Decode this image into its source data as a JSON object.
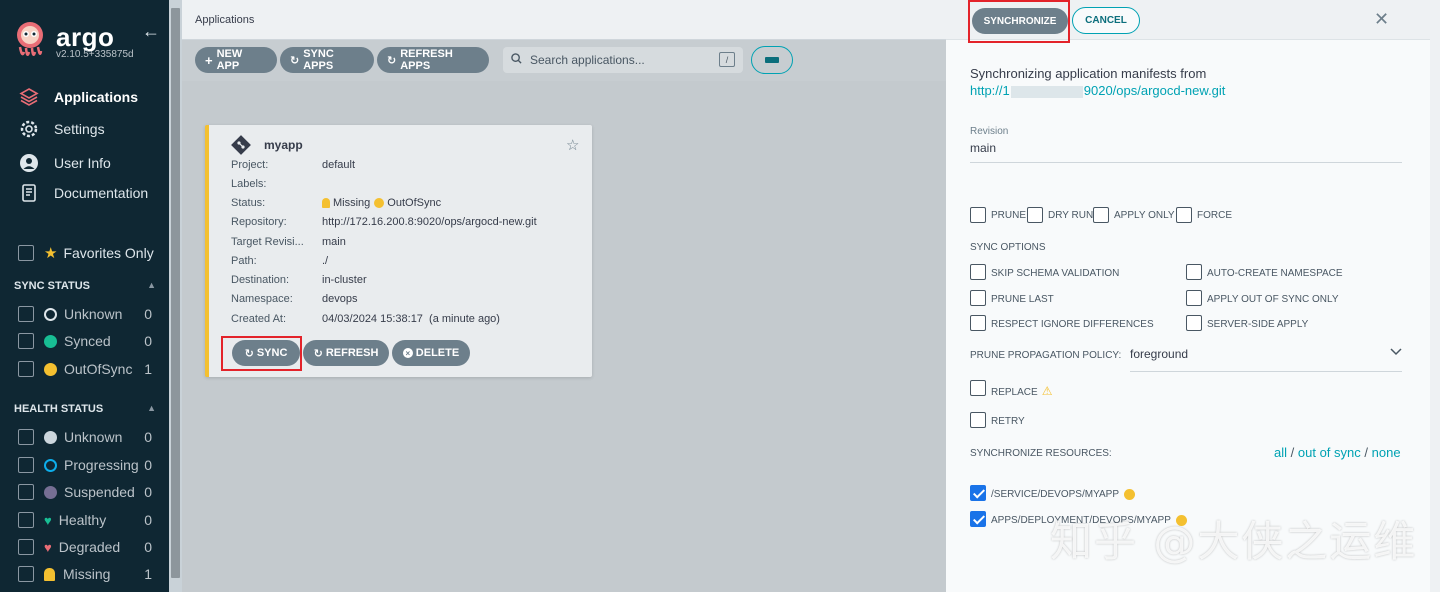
{
  "sidebar": {
    "brand": "argo",
    "version": "v2.10.5+335875d",
    "nav": [
      {
        "label": "Applications",
        "icon": "layers-icon"
      },
      {
        "label": "Settings",
        "icon": "gear-icon"
      },
      {
        "label": "User Info",
        "icon": "user-icon"
      },
      {
        "label": "Documentation",
        "icon": "book-icon"
      }
    ],
    "favorites_label": "Favorites Only",
    "sync_status": {
      "title": "SYNC STATUS",
      "items": [
        {
          "label": "Unknown",
          "count": "0",
          "color": "#dee6eb"
        },
        {
          "label": "Synced",
          "count": "0",
          "color": "#18be94"
        },
        {
          "label": "OutOfSync",
          "count": "1",
          "color": "#f4c030"
        }
      ]
    },
    "health_status": {
      "title": "HEALTH STATUS",
      "items": [
        {
          "label": "Unknown",
          "count": "0",
          "color": "#ccd6dd"
        },
        {
          "label": "Progressing",
          "count": "0",
          "color": "#0dadea"
        },
        {
          "label": "Suspended",
          "count": "0",
          "color": "#766f94"
        },
        {
          "label": "Healthy",
          "count": "0",
          "color": "#18be94"
        },
        {
          "label": "Degraded",
          "count": "0",
          "color": "#e96d76"
        },
        {
          "label": "Missing",
          "count": "1",
          "color": "#f4c030"
        }
      ]
    }
  },
  "header": {
    "breadcrumb": "Applications"
  },
  "toolbar": {
    "new_app": "NEW APP",
    "sync_apps": "SYNC APPS",
    "refresh_apps": "REFRESH APPS",
    "search_placeholder": "Search applications...",
    "search_shortcut": "/"
  },
  "app_card": {
    "name": "myapp",
    "fields": [
      {
        "key": "Project:",
        "value": "default"
      },
      {
        "key": "Labels:",
        "value": ""
      },
      {
        "key": "Status:",
        "value": ""
      },
      {
        "key": "Repository:",
        "value": "http://172.16.200.8:9020/ops/argocd-new.git"
      },
      {
        "key": "Target Revisi...",
        "value": "main"
      },
      {
        "key": "Path:",
        "value": "./"
      },
      {
        "key": "Destination:",
        "value": "in-cluster"
      },
      {
        "key": "Namespace:",
        "value": "devops"
      },
      {
        "key": "Created At:",
        "value": "04/03/2024 15:38:17  (a minute ago)"
      }
    ],
    "status_health": "Missing",
    "status_sync": "OutOfSync",
    "buttons": {
      "sync": "SYNC",
      "refresh": "REFRESH",
      "delete": "DELETE"
    }
  },
  "sync_panel": {
    "synchronize": "SYNCHRONIZE",
    "cancel": "CANCEL",
    "intro": "Synchronizing application manifests from",
    "repo_prefix": "http://1",
    "repo_suffix": "9020/ops/argocd-new.git",
    "revision_label": "Revision",
    "revision_value": "main",
    "basic_options": [
      "PRUNE",
      "DRY RUN",
      "APPLY ONLY",
      "FORCE"
    ],
    "sync_options_label": "SYNC OPTIONS",
    "sync_options": [
      "SKIP SCHEMA VALIDATION",
      "AUTO-CREATE NAMESPACE",
      "PRUNE LAST",
      "APPLY OUT OF SYNC ONLY",
      "RESPECT IGNORE DIFFERENCES",
      "SERVER-SIDE APPLY"
    ],
    "prune_policy_label": "PRUNE PROPAGATION POLICY:",
    "prune_policy_value": "foreground",
    "replace_label": "REPLACE",
    "retry_label": "RETRY",
    "resources_label": "SYNCHRONIZE RESOURCES:",
    "select_all": "all",
    "select_out_of_sync": "out of sync",
    "select_none": "none",
    "sep": "/",
    "resources": [
      "/SERVICE/DEVOPS/MYAPP",
      "APPS/DEPLOYMENT/DEVOPS/MYAPP"
    ]
  },
  "watermark": "知乎 @大侠之运维"
}
